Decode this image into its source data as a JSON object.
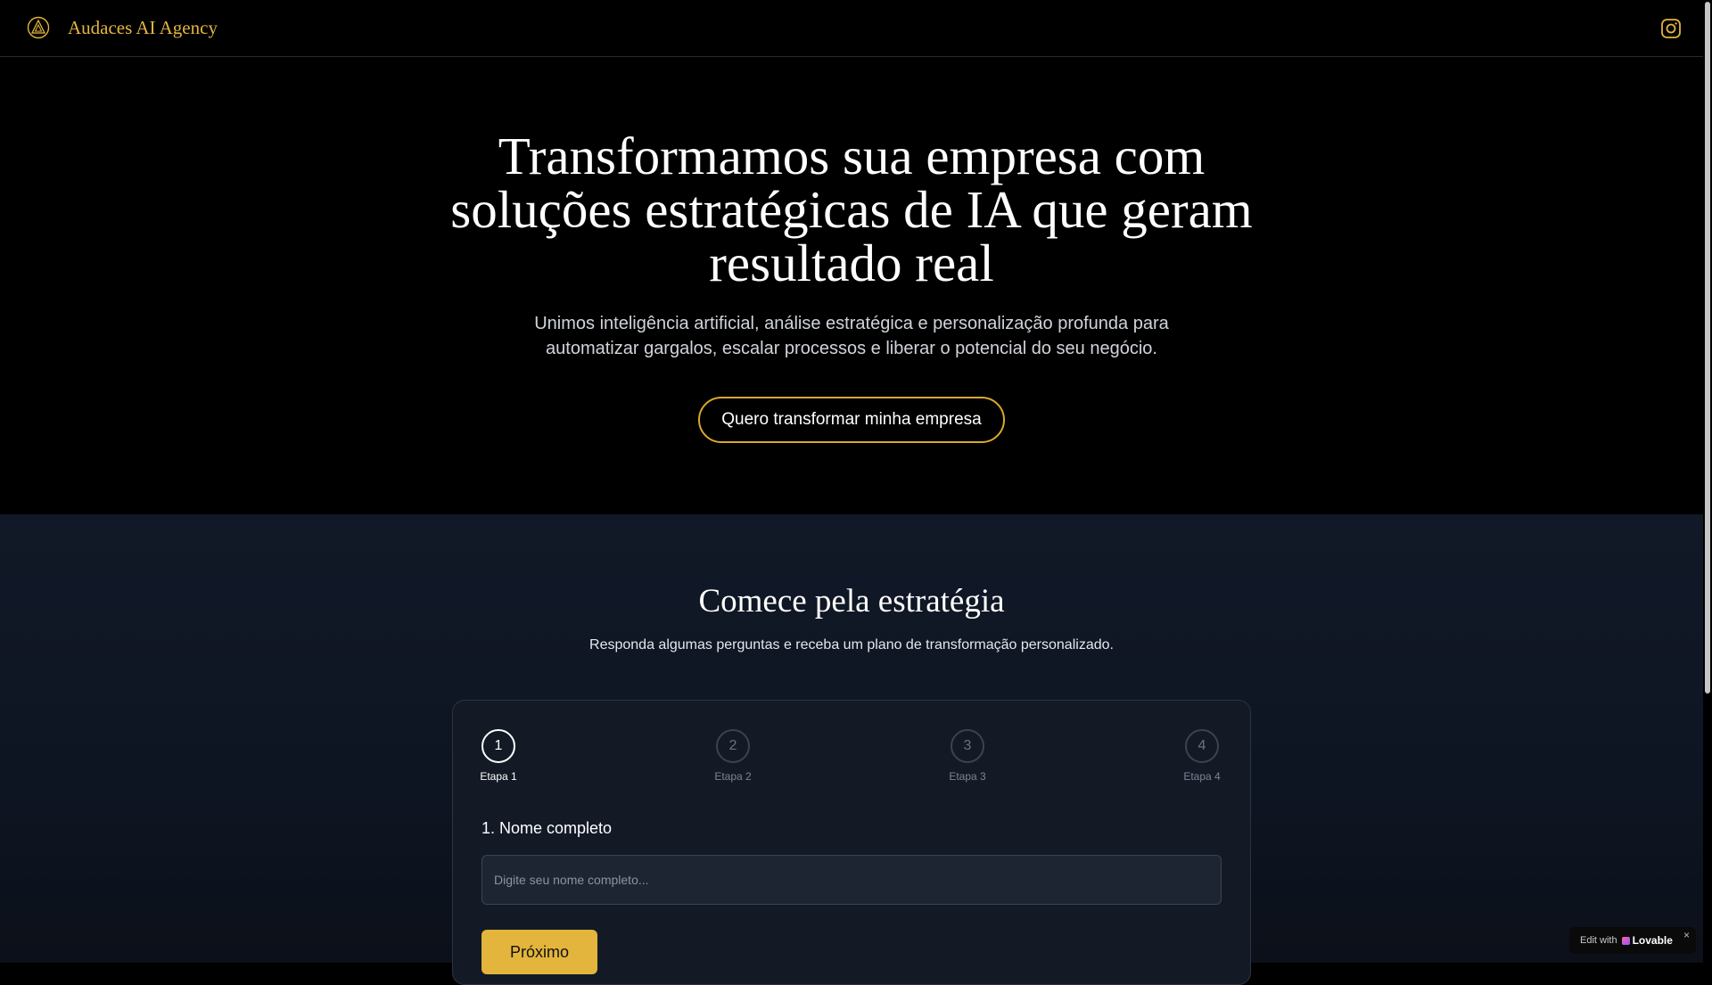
{
  "header": {
    "brand": "Audaces AI Agency",
    "logo_icon": "triangle-emblem-icon",
    "social_icon": "instagram-icon"
  },
  "hero": {
    "title": "Transformamos sua empresa com soluções estratégicas de IA que geram resultado real",
    "subtitle": "Unimos inteligência artificial, análise estratégica e personalização profunda para automatizar gargalos, escalar processos e liberar o potencial do seu negócio.",
    "cta_label": "Quero transformar minha empresa"
  },
  "strategy": {
    "title": "Comece pela estratégia",
    "subtitle": "Responda algumas perguntas e receba um plano de transformação personalizado.",
    "steps": [
      {
        "number": "1",
        "label": "Etapa 1",
        "active": true
      },
      {
        "number": "2",
        "label": "Etapa 2",
        "active": false
      },
      {
        "number": "3",
        "label": "Etapa 3",
        "active": false
      },
      {
        "number": "4",
        "label": "Etapa 4",
        "active": false
      }
    ],
    "question_label": "1. Nome completo",
    "name_placeholder": "Digite seu nome completo...",
    "name_value": "",
    "next_label": "Próximo"
  },
  "badge": {
    "prefix": "Edit with",
    "brand": "Lovable",
    "close": "×"
  },
  "colors": {
    "accent": "#e3b53c",
    "cta_border": "#d9a92b",
    "background": "#000000",
    "section_background": "#111827",
    "card_background": "#131a26"
  }
}
